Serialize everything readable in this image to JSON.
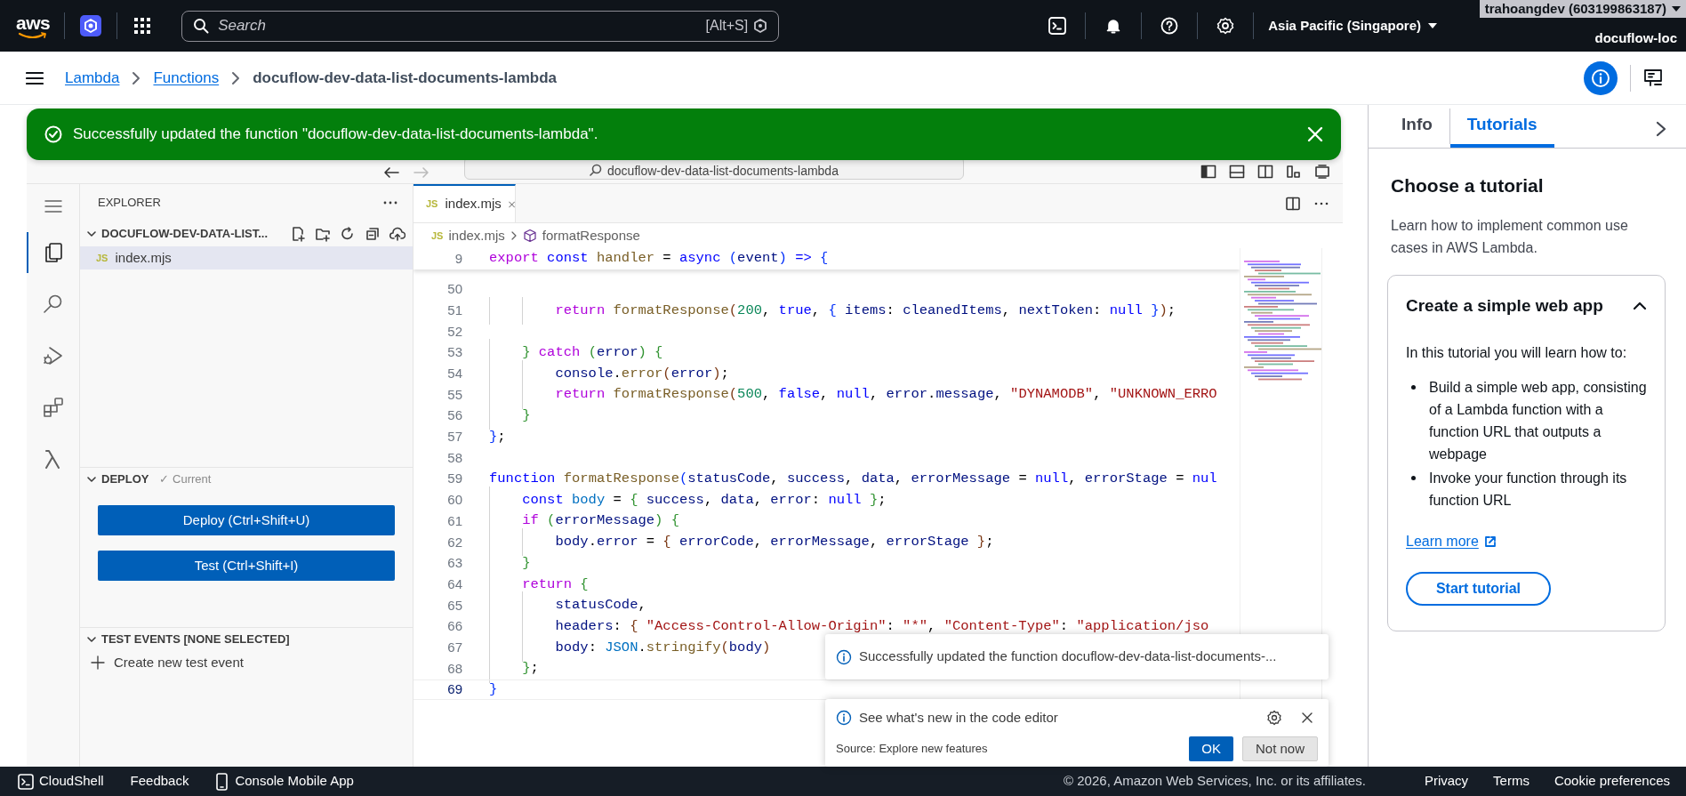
{
  "top_nav": {
    "logo": "aws",
    "search_placeholder": "Search",
    "search_shortcut": "[Alt+S]",
    "region": "Asia Pacific (Singapore)",
    "account": "trahoangdev (603199863187)",
    "role": "docuflow-loc"
  },
  "breadcrumbs": [
    {
      "label": "Lambda",
      "link": true
    },
    {
      "label": "Functions",
      "link": true
    },
    {
      "label": "docuflow-dev-data-list-documents-lambda",
      "link": false
    }
  ],
  "flash": {
    "message": "Successfully updated the function \"docuflow-dev-data-list-documents-lambda\"."
  },
  "editor": {
    "title": "docuflow-dev-data-list-documents-lambda",
    "activity": [
      {
        "kind": "menu",
        "selected": false
      },
      {
        "kind": "files",
        "selected": true
      },
      {
        "kind": "search",
        "selected": false
      },
      {
        "kind": "debug",
        "selected": false
      },
      {
        "kind": "extensions",
        "selected": false
      },
      {
        "kind": "lambda",
        "selected": false
      }
    ],
    "explorer": {
      "title": "EXPLORER",
      "folder": {
        "name": "DOCUFLOW-DEV-DATA-LIST...",
        "expanded": true,
        "children": [
          {
            "badge": "JS",
            "name": "index.mjs",
            "selected": true
          }
        ]
      }
    },
    "deploy": {
      "title": "DEPLOY",
      "status": "✓ Current",
      "expanded": true,
      "buttons": [
        "Deploy (Ctrl+Shift+U)",
        "Test (Ctrl+Shift+I)"
      ]
    },
    "test_events": {
      "title": "TEST EVENTS [NONE SELECTED]",
      "expanded": true,
      "action": "Create new test event"
    },
    "tabs": [
      {
        "badge": "JS",
        "label": "index.mjs",
        "selected": true
      }
    ],
    "path": {
      "badge": "JS",
      "file": "index.mjs",
      "symbol": "formatResponse"
    },
    "sticky_line": {
      "number": "9",
      "tokens": [
        {
          "kind": "control",
          "text": "export"
        },
        {
          "kind": "keyword",
          "text": " const"
        },
        {
          "kind": "function",
          "text": " handler"
        },
        {
          "kind": "plain",
          "text": " = "
        },
        {
          "kind": "keyword",
          "text": "async"
        },
        {
          "kind": "bracket1",
          "text": " ("
        },
        {
          "kind": "variable",
          "text": "event"
        },
        {
          "kind": "bracket1",
          "text": ")"
        },
        {
          "kind": "keyword",
          "text": " =>"
        },
        {
          "kind": "bracket1",
          "text": " {"
        }
      ]
    },
    "lines": [
      {
        "number": "50",
        "current": false
      },
      {
        "number": "51",
        "current": false,
        "tokens": [
          {
            "kind": "control",
            "text": "        return"
          },
          {
            "kind": "function",
            "text": " formatResponse"
          },
          {
            "kind": "bracket3",
            "text": "("
          },
          {
            "kind": "number",
            "text": "200"
          },
          {
            "kind": "plain",
            "text": ", "
          },
          {
            "kind": "keyword",
            "text": "true"
          },
          {
            "kind": "plain",
            "text": ", "
          },
          {
            "kind": "bracket1",
            "text": "{"
          },
          {
            "kind": "variable",
            "text": " items"
          },
          {
            "kind": "plain",
            "text": ": "
          },
          {
            "kind": "variable",
            "text": "cleanedItems"
          },
          {
            "kind": "plain",
            "text": ", "
          },
          {
            "kind": "variable",
            "text": "nextToken"
          },
          {
            "kind": "plain",
            "text": ": "
          },
          {
            "kind": "keyword",
            "text": "null"
          },
          {
            "kind": "bracket1",
            "text": " }"
          },
          {
            "kind": "bracket3",
            "text": ")"
          },
          {
            "kind": "plain",
            "text": ";"
          }
        ]
      },
      {
        "number": "52",
        "current": false
      },
      {
        "number": "53",
        "current": false,
        "tokens": [
          {
            "kind": "bracket2",
            "text": "    }"
          },
          {
            "kind": "control",
            "text": " catch"
          },
          {
            "kind": "bracket2",
            "text": " ("
          },
          {
            "kind": "variable",
            "text": "error"
          },
          {
            "kind": "bracket2",
            "text": ")"
          },
          {
            "kind": "bracket2",
            "text": " {"
          }
        ]
      },
      {
        "number": "54",
        "current": false,
        "tokens": [
          {
            "kind": "variable",
            "text": "        console"
          },
          {
            "kind": "plain",
            "text": "."
          },
          {
            "kind": "function",
            "text": "error"
          },
          {
            "kind": "bracket3",
            "text": "("
          },
          {
            "kind": "variable",
            "text": "error"
          },
          {
            "kind": "bracket3",
            "text": ")"
          },
          {
            "kind": "plain",
            "text": ";"
          }
        ]
      },
      {
        "number": "55",
        "current": false,
        "tokens": [
          {
            "kind": "control",
            "text": "        return"
          },
          {
            "kind": "function",
            "text": " formatResponse"
          },
          {
            "kind": "bracket3",
            "text": "("
          },
          {
            "kind": "number",
            "text": "500"
          },
          {
            "kind": "plain",
            "text": ", "
          },
          {
            "kind": "keyword",
            "text": "false"
          },
          {
            "kind": "plain",
            "text": ", "
          },
          {
            "kind": "keyword",
            "text": "null"
          },
          {
            "kind": "plain",
            "text": ", "
          },
          {
            "kind": "variable",
            "text": "error"
          },
          {
            "kind": "plain",
            "text": "."
          },
          {
            "kind": "variable",
            "text": "message"
          },
          {
            "kind": "plain",
            "text": ", "
          },
          {
            "kind": "string",
            "text": "\"DYNAMODB\""
          },
          {
            "kind": "plain",
            "text": ", "
          },
          {
            "kind": "string",
            "text": "\"UNKNOWN_ERRO"
          }
        ]
      },
      {
        "number": "56",
        "current": false,
        "tokens": [
          {
            "kind": "bracket2",
            "text": "    }"
          }
        ]
      },
      {
        "number": "57",
        "current": false,
        "tokens": [
          {
            "kind": "bracket1",
            "text": "}"
          },
          {
            "kind": "plain",
            "text": ";"
          }
        ]
      },
      {
        "number": "58",
        "current": false
      },
      {
        "number": "59",
        "current": false,
        "tokens": [
          {
            "kind": "keyword",
            "text": "function"
          },
          {
            "kind": "function",
            "text": " formatResponse"
          },
          {
            "kind": "bracket1",
            "text": "("
          },
          {
            "kind": "variable",
            "text": "statusCode"
          },
          {
            "kind": "plain",
            "text": ", "
          },
          {
            "kind": "variable",
            "text": "success"
          },
          {
            "kind": "plain",
            "text": ", "
          },
          {
            "kind": "variable",
            "text": "data"
          },
          {
            "kind": "plain",
            "text": ", "
          },
          {
            "kind": "variable",
            "text": "errorMessage"
          },
          {
            "kind": "plain",
            "text": " = "
          },
          {
            "kind": "keyword",
            "text": "null"
          },
          {
            "kind": "plain",
            "text": ", "
          },
          {
            "kind": "variable",
            "text": "errorStage"
          },
          {
            "kind": "plain",
            "text": " = "
          },
          {
            "kind": "keyword",
            "text": "nul"
          }
        ]
      },
      {
        "number": "60",
        "current": false,
        "tokens": [
          {
            "kind": "keyword",
            "text": "    const"
          },
          {
            "kind": "constant",
            "text": " body"
          },
          {
            "kind": "plain",
            "text": " = "
          },
          {
            "kind": "bracket2",
            "text": "{"
          },
          {
            "kind": "variable",
            "text": " success"
          },
          {
            "kind": "plain",
            "text": ", "
          },
          {
            "kind": "variable",
            "text": "data"
          },
          {
            "kind": "plain",
            "text": ", "
          },
          {
            "kind": "variable",
            "text": "error"
          },
          {
            "kind": "plain",
            "text": ": "
          },
          {
            "kind": "keyword",
            "text": "null"
          },
          {
            "kind": "bracket2",
            "text": " }"
          },
          {
            "kind": "plain",
            "text": ";"
          }
        ]
      },
      {
        "number": "61",
        "current": false,
        "tokens": [
          {
            "kind": "control",
            "text": "    if"
          },
          {
            "kind": "bracket2",
            "text": " ("
          },
          {
            "kind": "variable",
            "text": "errorMessage"
          },
          {
            "kind": "bracket2",
            "text": ")"
          },
          {
            "kind": "bracket2",
            "text": " {"
          }
        ]
      },
      {
        "number": "62",
        "current": false,
        "tokens": [
          {
            "kind": "variable",
            "text": "        body"
          },
          {
            "kind": "plain",
            "text": "."
          },
          {
            "kind": "variable",
            "text": "error"
          },
          {
            "kind": "plain",
            "text": " = "
          },
          {
            "kind": "bracket3",
            "text": "{"
          },
          {
            "kind": "variable",
            "text": " errorCode"
          },
          {
            "kind": "plain",
            "text": ", "
          },
          {
            "kind": "variable",
            "text": "errorMessage"
          },
          {
            "kind": "plain",
            "text": ", "
          },
          {
            "kind": "variable",
            "text": "errorStage"
          },
          {
            "kind": "bracket3",
            "text": " }"
          },
          {
            "kind": "plain",
            "text": ";"
          }
        ]
      },
      {
        "number": "63",
        "current": false,
        "tokens": [
          {
            "kind": "bracket2",
            "text": "    }"
          }
        ]
      },
      {
        "number": "64",
        "current": false,
        "tokens": [
          {
            "kind": "control",
            "text": "    return"
          },
          {
            "kind": "bracket2",
            "text": " {"
          }
        ]
      },
      {
        "number": "65",
        "current": false,
        "tokens": [
          {
            "kind": "variable",
            "text": "        statusCode"
          },
          {
            "kind": "plain",
            "text": ","
          }
        ]
      },
      {
        "number": "66",
        "current": false,
        "tokens": [
          {
            "kind": "variable",
            "text": "        headers"
          },
          {
            "kind": "plain",
            "text": ": "
          },
          {
            "kind": "bracket3",
            "text": "{"
          },
          {
            "kind": "string",
            "text": " \"Access-Control-Allow-Origin\""
          },
          {
            "kind": "plain",
            "text": ": "
          },
          {
            "kind": "string",
            "text": "\"*\""
          },
          {
            "kind": "plain",
            "text": ", "
          },
          {
            "kind": "string",
            "text": "\"Content-Type\""
          },
          {
            "kind": "plain",
            "text": ": "
          },
          {
            "kind": "string",
            "text": "\"application/jso"
          }
        ]
      },
      {
        "number": "67",
        "current": false,
        "tokens": [
          {
            "kind": "variable",
            "text": "        body"
          },
          {
            "kind": "plain",
            "text": ": "
          },
          {
            "kind": "constant",
            "text": "JSON"
          },
          {
            "kind": "plain",
            "text": "."
          },
          {
            "kind": "function",
            "text": "stringify"
          },
          {
            "kind": "bracket3",
            "text": "("
          },
          {
            "kind": "variable",
            "text": "body"
          },
          {
            "kind": "bracket3",
            "text": ")"
          }
        ]
      },
      {
        "number": "68",
        "current": false,
        "tokens": [
          {
            "kind": "bracket2",
            "text": "    }"
          },
          {
            "kind": "plain",
            "text": ";"
          }
        ]
      },
      {
        "number": "69",
        "current": true,
        "tokens": [
          {
            "kind": "bracket1",
            "text": "}"
          }
        ]
      }
    ],
    "notifications": [
      {
        "message": "Successfully updated the function docuflow-dev-data-list-documents-..."
      },
      {
        "message": "See what's new in the code editor",
        "source": "Source: Explore new features",
        "buttons": [
          {
            "label": "OK",
            "primary": true
          },
          {
            "label": "Not now",
            "primary": false
          }
        ]
      }
    ]
  },
  "side_panel": {
    "tabs": [
      {
        "label": "Info",
        "selected": false
      },
      {
        "label": "Tutorials",
        "selected": true
      }
    ],
    "heading": "Choose a tutorial",
    "description": "Learn how to implement common use cases in AWS Lambda.",
    "card": {
      "title": "Create a simple web app",
      "expanded": true,
      "intro": "In this tutorial you will learn how to:",
      "bullets": [
        "Build a simple web app, consisting of a Lambda function with a function URL that outputs a webpage",
        "Invoke your function through its function URL"
      ],
      "link": "Learn more",
      "button": "Start tutorial"
    }
  },
  "footer": {
    "items": [
      {
        "kind": "cloudshell",
        "label": "CloudShell"
      },
      {
        "kind": "text",
        "label": "Feedback"
      },
      {
        "kind": "mobile",
        "label": "Console Mobile App"
      }
    ],
    "copyright": "© 2026, Amazon Web Services, Inc. or its affiliates.",
    "links": [
      "Privacy",
      "Terms",
      "Cookie preferences"
    ]
  }
}
